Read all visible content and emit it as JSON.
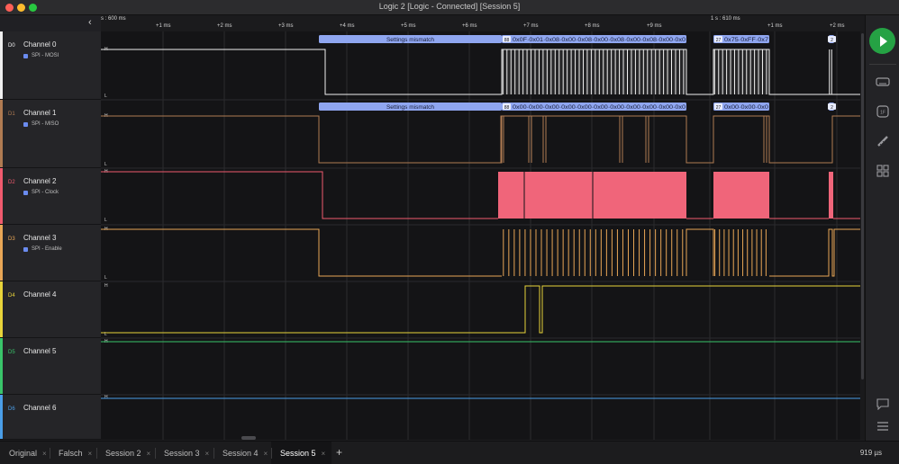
{
  "window": {
    "title": "Logic 2 [Logic - Connected] [Session 5]",
    "lights": [
      "#fe5f57",
      "#febc2e",
      "#28c840"
    ]
  },
  "timeline": {
    "left_label": "s : 600 ms",
    "right_label": "1 s : 610 ms",
    "ticks": [
      "+1 ms",
      "+2 ms",
      "+3 ms",
      "+4 ms",
      "+5 ms",
      "+6 ms",
      "+7 ms",
      "+8 ms",
      "+9 ms",
      "+1 ms",
      "+2 ms"
    ]
  },
  "channels": [
    {
      "id": "D0",
      "name": "Channel 0",
      "analyzer": "SPI - MOSI",
      "color": "#f0f0f0"
    },
    {
      "id": "D1",
      "name": "Channel 1",
      "analyzer": "SPI - MISO",
      "color": "#b07b52"
    },
    {
      "id": "D2",
      "name": "Channel 2",
      "analyzer": "SPI - Clock",
      "color": "#f05a6e"
    },
    {
      "id": "D3",
      "name": "Channel 3",
      "analyzer": "SPI - Enable",
      "color": "#e8a656"
    },
    {
      "id": "D4",
      "name": "Channel 4",
      "analyzer": "",
      "color": "#e8d43a"
    },
    {
      "id": "D5",
      "name": "Channel 5",
      "analyzer": "",
      "color": "#39c46a"
    },
    {
      "id": "D6",
      "name": "Channel 6",
      "analyzer": "",
      "color": "#4a9ee8"
    }
  ],
  "levels": {
    "high": "H",
    "low": "L"
  },
  "annotations": {
    "mosi": {
      "mismatch": "Settings mismatch",
      "tag1": "88",
      "bytes1": "0x0F·0x01·0x08·0x00·0x08·0x00·0x08·0x00·0x08·0x00·0x0",
      "tag2": "27",
      "bytes2": "0x75·0xFF·0x7",
      "tag3": "2"
    },
    "miso": {
      "mismatch": "Settings mismatch",
      "tag1": "88",
      "bytes1": "0x00·0x00·0x00·0x00·0x00·0x00·0x00·0x00·0x00·0x00·0x0",
      "tag2": "27",
      "bytes2": "0x00·0x00·0x0",
      "tag3": "2"
    }
  },
  "colors": {
    "annotation_bg": "#8fa6f0",
    "annotation_text": "#1a1f3a",
    "clock_fill": "#f0657a",
    "run_button": "#25a244"
  },
  "tabs": [
    {
      "label": "Original",
      "close": "×"
    },
    {
      "label": "Falsch",
      "close": "×"
    },
    {
      "label": "Session 2",
      "close": "×"
    },
    {
      "label": "Session 3",
      "close": "×"
    },
    {
      "label": "Session 4",
      "close": "×"
    },
    {
      "label": "Session 5",
      "close": "×",
      "active": true
    }
  ],
  "add_tab": "+",
  "status": "919 µs",
  "right_toolbar": [
    "play-icon",
    "device-icon",
    "analyzers-icon",
    "measure-icon",
    "extensions-icon",
    "comment-icon",
    "menu-icon"
  ]
}
